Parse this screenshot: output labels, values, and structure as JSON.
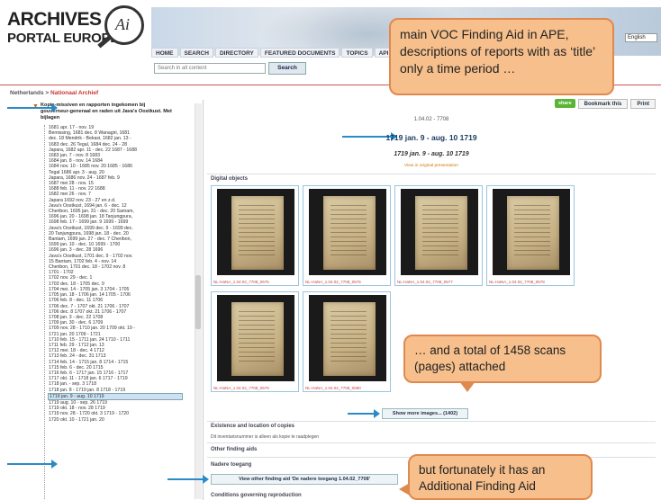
{
  "header": {
    "logo_line1": "ARCHIVES",
    "logo_line2": "PORTAL EUROPE",
    "logo_mark": "Ai",
    "nav": [
      "HOME",
      "SEARCH",
      "DIRECTORY",
      "FEATURED DOCUMENTS",
      "TOPICS",
      "API"
    ],
    "search_placeholder": "Search in all content",
    "search_button": "Search",
    "language": "English"
  },
  "breadcrumb": {
    "country": "Netherlands",
    "sep": " > ",
    "archive": "Nationaal Archief"
  },
  "tree": {
    "root": "Kopie-missiven en rapporten ingekomen bij gouverneur-generaal en raden uit Java's Oostkust. Met bijlagen",
    "items": [
      "1681 apr. 17 - nov. 19",
      "Bemissing, 1681 dec. 8 Wanagiri, 1681",
      "dec. 18 Mendrik - Bekasi, 1682 jan. 13 -",
      "1683 dec. 26 Tegal, 1684 dec. 24 - 28",
      "Japara, 1682 apr. 11 - dec. 22 1687 - 1688",
      "1683 jan. 7 - nov. 8 1683",
      "1684 jan. 8 - nov. 14 1684",
      "1684 nov. 10 - 1685 nov. 20 1685 - 1686",
      "Tegal 1686 apr. 3 - aug. 20",
      "Japara, 1686 nov. 24 - 1687 feb. 9",
      "1687 mei 28 - nov. 15",
      "1688 feb. 11 - nov. 22 1688",
      "1682 mei 26 - nov. 7",
      "Japara 1692 nov. 23 - 27 en z.d.",
      "Java's Oostkust, 1694 jan. 6 - dec. 12",
      "Cheribon, 1695 jan. 31 - dec. 20 Samam,",
      "1696 jan. 20 - 1698 jan. 18 Tanjungpura,",
      "1698 feb. 17 - 1699 jan. 9 1699 - 1699",
      "Java's Oostkust, 1699 dec. 9 - 1699 dec.",
      "20 Tanjungpura, 1698 jan. 18 - dec. 20",
      "Bantam, 1699 jan. 27 - dec. 7 Cheribon,",
      "1699 jan. 10 - dec. 10 1699 - 1700",
      "1696 jan. 3 - dec. 28 1696",
      "Java's Oostkust, 1701 dec. 9 - 1702 nov.",
      "15 Bantam, 1702 feb. 4 - nov. 14",
      "Cheribon, 1701 dec. 18 - 1702 nov. 8",
      "1701 - 1702",
      "1702 nov. 29 - dec. 1",
      "1703 dec. 18 - 1705 dec. 9",
      "1704 mei. 14 - 1705 jan. 3 1704 - 1705",
      "1705 jan. 18 - 1706 jan. 14 1705 - 1706",
      "1706 feb. 8 - dec. 11 1706",
      "1706 dec. 7 - 1707 okt. 21 1706 - 1707",
      "1706 dec. 8 1707 okt. 21 1706 - 1707",
      "1708 jan. 3 - dec. 22 1708",
      "1709 jan. 30 - dec. 6 1709",
      "1709 nov. 28 - 1710 jan. 20 1709 okt. 19 -",
      "1721 jan. 20 1709 - 1721",
      "1710 feb. 15 - 1711 jan. 24 1710 - 1711",
      "1711 feb. 29 - 1712 jan. 13",
      "1712 mei. 18 - dec. 4 1712",
      "1713 feb. 24 - dec. 31 1713",
      "1714 feb. 14 - 1715 jan. 8 1714 - 1715",
      "1715 feb. 6 - dec. 20 1715",
      "1716 feb. 6 - 1717 jan. 15 1716 - 1717",
      "1717 okt. 11 - 1718 jan. 6 1717 - 1719",
      "1718 jan. - sep. 3 1718",
      "1718 jan. 8 - 1719 jan. 8 1718 - 1719",
      "1719 jan. 9 - aug. 10 1719",
      "1719 aug. 10 - sep. 26 1719",
      "1719 okt. 18 - nov. 28 1719",
      "1719 nov. 28 - 1720 okt. 3 1719 - 1720",
      "1720 okt. 10 - 1721 jan. 20"
    ],
    "selected_index": 48
  },
  "record": {
    "share": "share",
    "bookmark": "Bookmark this",
    "print": "Print",
    "code": "1.04.02 - 7708",
    "title": "1719 jan. 9 - aug. 10 1719",
    "subtitle": "1719 jan. 9 - aug. 10 1719",
    "view_original": "View in original presentation"
  },
  "digital_objects": {
    "heading": "Digital objects",
    "captions": [
      "NL-HaNA_1.04.02_7708_0575",
      "NL-HaNA_1.04.02_7708_0576",
      "NL-HaNA_1.04.02_7708_0577",
      "NL-HaNA_1.04.02_7708_0578",
      "NL-HaNA_1.04.02_7708_0579",
      "NL-HaNA_1.04.02_7708_0580"
    ],
    "more_button": "Show more images... (1402)"
  },
  "sections": {
    "existence": "Existence and location of copies",
    "existence_text": "Dit inventarisnummer is alleen als kopie te raadplegen",
    "other_aids": "Other finding aids",
    "nadere": "Nadere toegang",
    "view_other": "View other finding aid 'De nadere toegang 1.04.02_7708'",
    "conditions": "Conditions governing reproduction"
  },
  "callouts": {
    "c1": "main VOC Finding Aid in APE, descriptions of reports with as ‘title’ only a time period …",
    "c2": "… and a total of 1458 scans (pages) attached",
    "c3": "but fortunately it has an Additional Finding Aid"
  },
  "colors": {
    "accent": "#2a8bc7",
    "callout_fill": "#f6bf8c",
    "callout_border": "#e0894f",
    "link_red": "#c33"
  }
}
